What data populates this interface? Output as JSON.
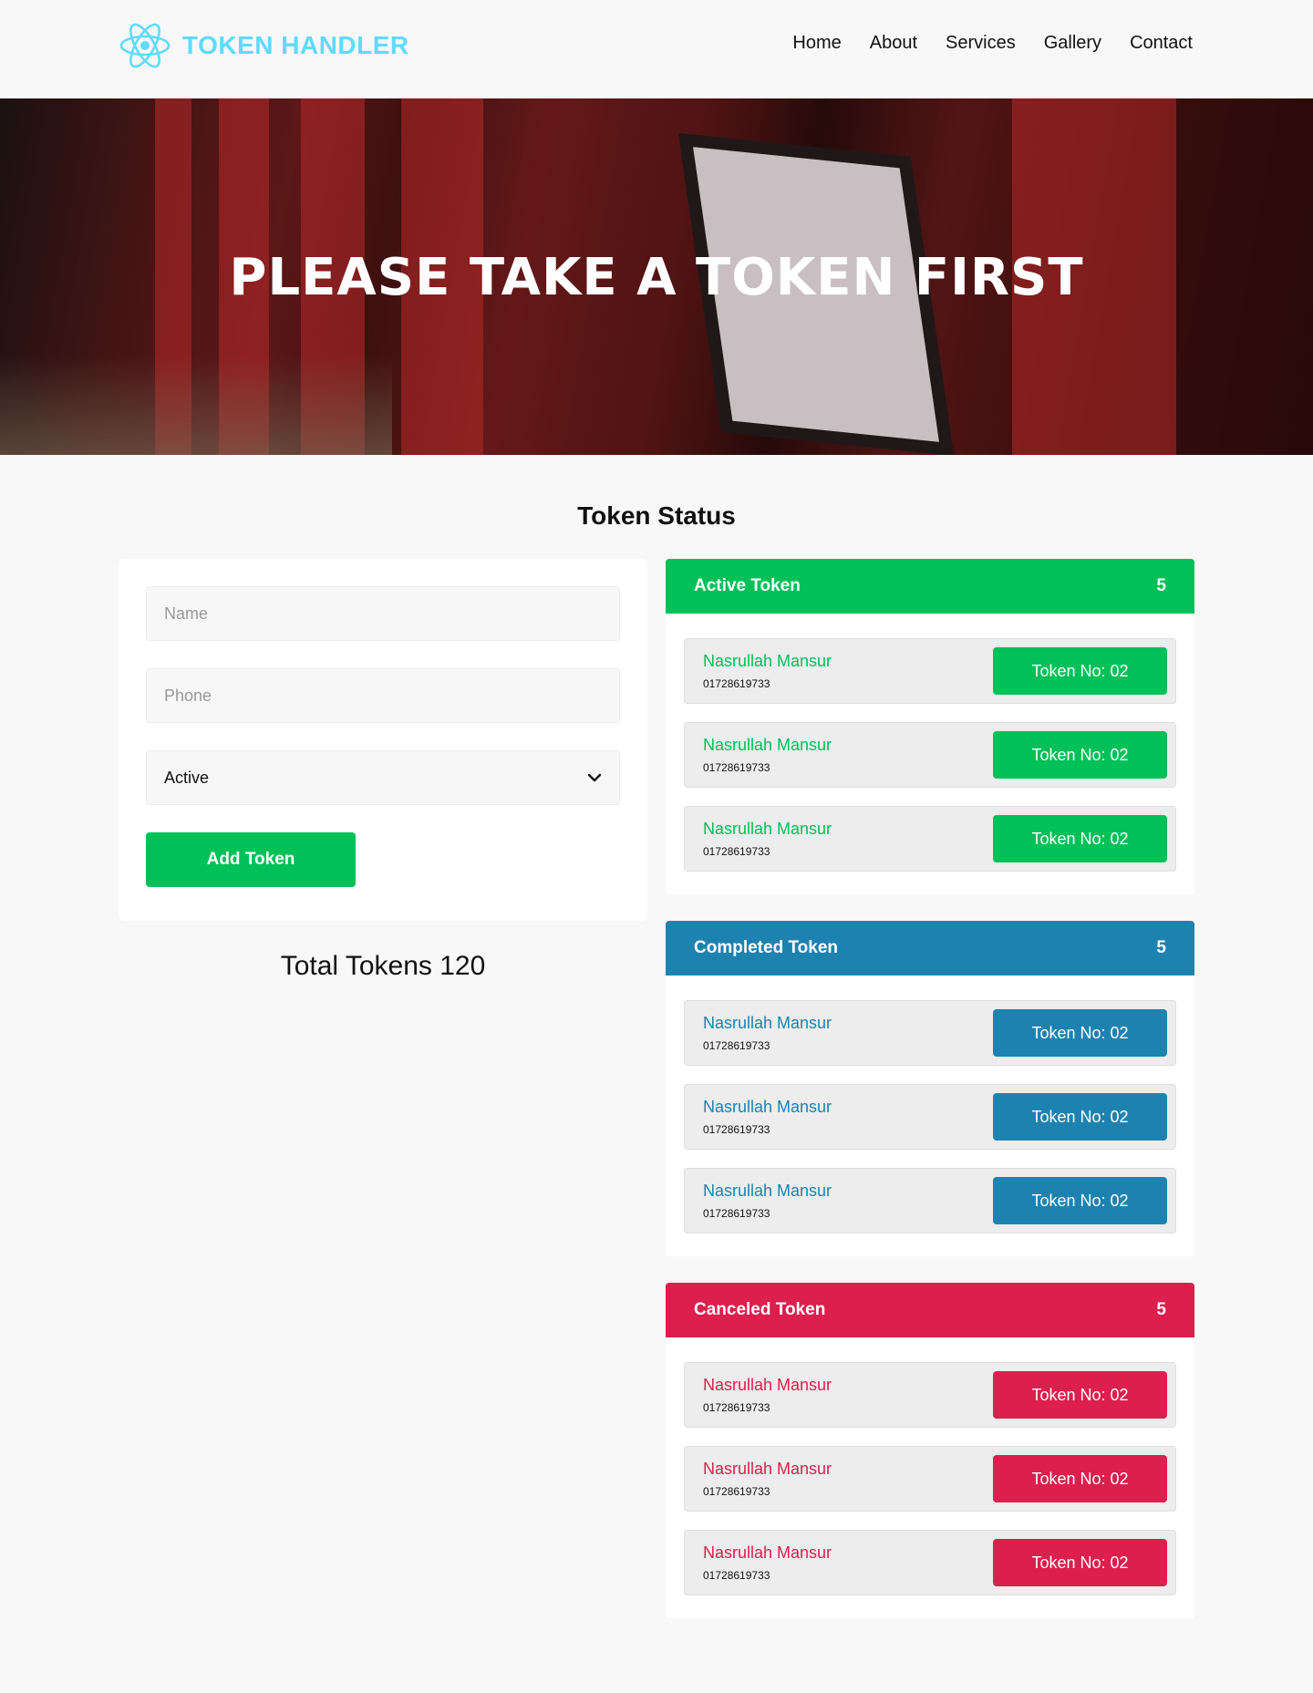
{
  "nav": {
    "brand": "TOKEN HANDLER",
    "logo_icon": "react-atom-icon",
    "links": [
      "Home",
      "About",
      "Services",
      "Gallery",
      "Contact"
    ]
  },
  "hero": {
    "title": "PLEASE TAKE A TOKEN FIRST"
  },
  "main": {
    "title": "Token Status",
    "form": {
      "name_placeholder": "Name",
      "phone_placeholder": "Phone",
      "status_value": "Active",
      "add_label": "Add Token"
    },
    "total_label": "Total Tokens 120"
  },
  "colors": {
    "active": "#00c058",
    "completed": "#1e82b0",
    "canceled": "#dc1f4c",
    "brand": "#61dafb"
  },
  "panels": [
    {
      "title": "Active Token",
      "count": "5",
      "color": "#00c058",
      "rows": [
        {
          "name": "Nasrullah Mansur",
          "phone": "01728619733",
          "token": "Token No: 02"
        },
        {
          "name": "Nasrullah Mansur",
          "phone": "01728619733",
          "token": "Token No: 02"
        },
        {
          "name": "Nasrullah Mansur",
          "phone": "01728619733",
          "token": "Token No: 02"
        }
      ]
    },
    {
      "title": "Completed Token",
      "count": "5",
      "color": "#1e82b0",
      "rows": [
        {
          "name": "Nasrullah Mansur",
          "phone": "01728619733",
          "token": "Token No: 02"
        },
        {
          "name": "Nasrullah Mansur",
          "phone": "01728619733",
          "token": "Token No: 02"
        },
        {
          "name": "Nasrullah Mansur",
          "phone": "01728619733",
          "token": "Token No: 02"
        }
      ]
    },
    {
      "title": "Canceled Token",
      "count": "5",
      "color": "#dc1f4c",
      "rows": [
        {
          "name": "Nasrullah Mansur",
          "phone": "01728619733",
          "token": "Token No: 02"
        },
        {
          "name": "Nasrullah Mansur",
          "phone": "01728619733",
          "token": "Token No: 02"
        },
        {
          "name": "Nasrullah Mansur",
          "phone": "01728619733",
          "token": "Token No: 02"
        }
      ]
    }
  ]
}
